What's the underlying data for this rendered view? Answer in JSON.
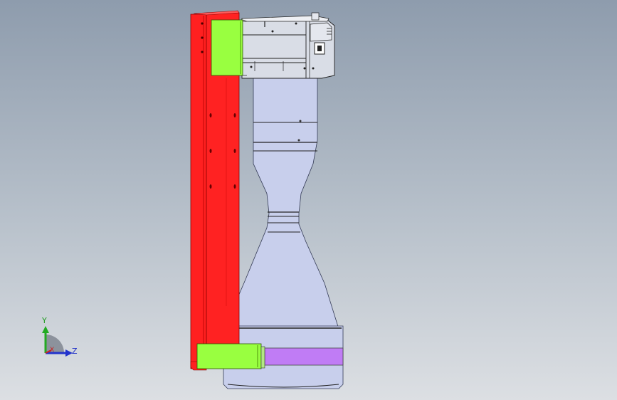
{
  "viewport": {
    "background_top": "#8e9cad",
    "background_bottom": "#dcdfe3"
  },
  "parts": {
    "column_color": "#ff2020",
    "motor_color": "#d9dde6",
    "bracket_color": "#99ff40",
    "nozzle_color": "#c8cfec",
    "band_color": "#c07cf5"
  },
  "triad": {
    "y_label": "Y",
    "z_label": "Z",
    "x_label": "X",
    "y_color": "#22aa22",
    "z_color": "#2233cc",
    "x_color": "#cc2222"
  }
}
